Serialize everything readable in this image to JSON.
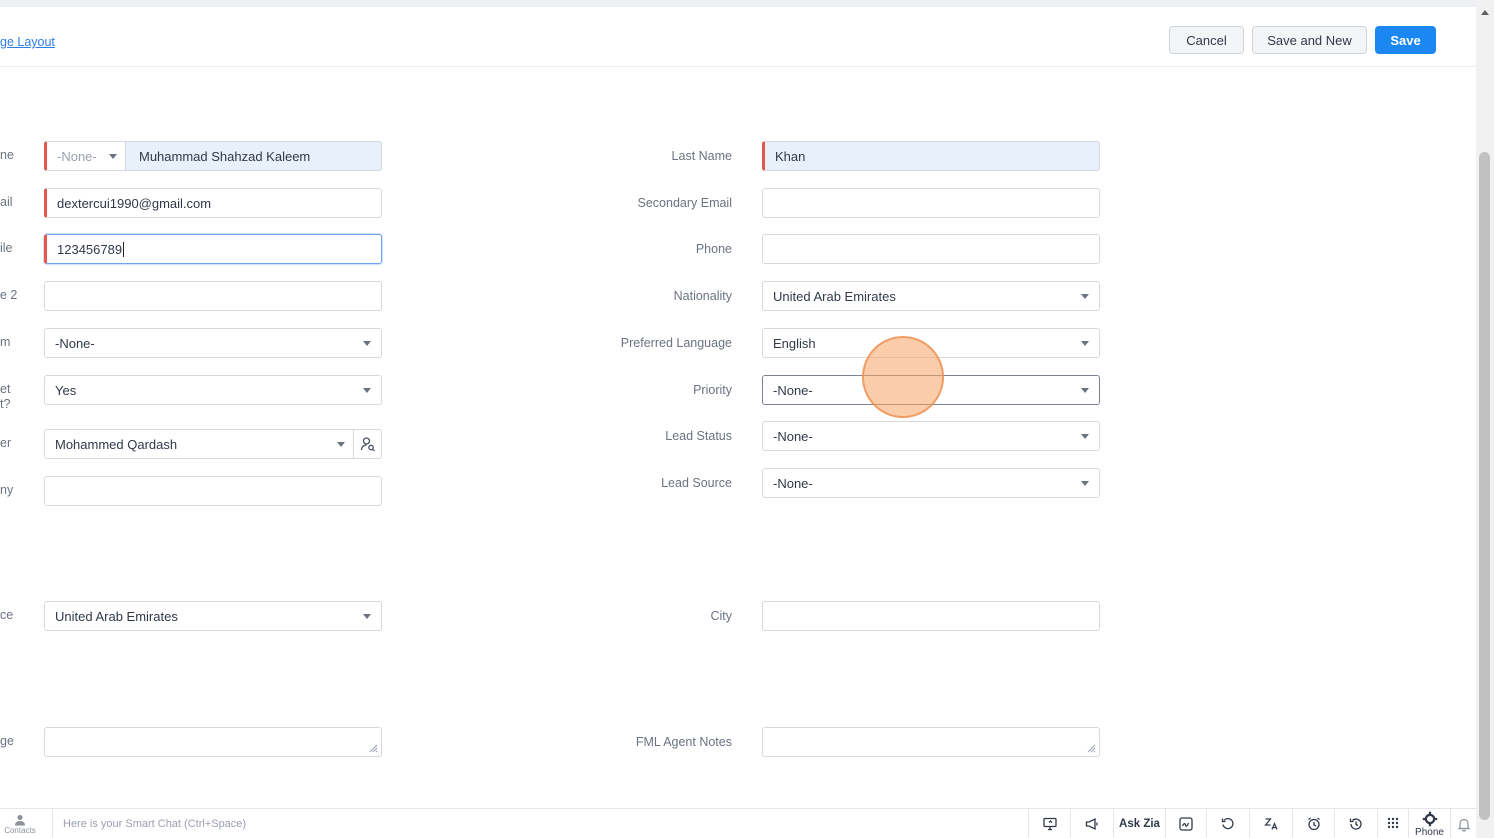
{
  "header": {
    "layout_link": "ge Layout",
    "cancel_label": "Cancel",
    "save_new_label": "Save and New",
    "save_label": "Save"
  },
  "left_fields": {
    "first_name": {
      "label": "ne",
      "salutation": "-None-",
      "value": "Muhammad Shahzad Kaleem"
    },
    "email": {
      "label": "ail",
      "value": "dextercui1990@gmail.com"
    },
    "mobile": {
      "label": "ile",
      "value": "123456789"
    },
    "phone2": {
      "label": "e 2",
      "value": ""
    },
    "platform": {
      "label": "m",
      "value": "-None-"
    },
    "meet": {
      "label_line1": "et",
      "label_line2": "t?",
      "value": "Yes"
    },
    "owner": {
      "label": "er",
      "value": "Mohammed Qardash"
    },
    "company": {
      "label": "ny",
      "value": ""
    },
    "residence": {
      "label": "ce",
      "value": "United Arab Emirates"
    },
    "message": {
      "label": "ge",
      "value": ""
    }
  },
  "right_fields": {
    "last_name": {
      "label": "Last Name",
      "value": "Khan"
    },
    "secondary_email": {
      "label": "Secondary Email",
      "value": ""
    },
    "phone": {
      "label": "Phone",
      "value": ""
    },
    "nationality": {
      "label": "Nationality",
      "value": "United Arab Emirates"
    },
    "preferred_language": {
      "label": "Preferred Language",
      "value": "English"
    },
    "priority": {
      "label": "Priority",
      "value": "-None-"
    },
    "lead_status": {
      "label": "Lead Status",
      "value": "-None-"
    },
    "lead_source": {
      "label": "Lead Source",
      "value": "-None-"
    },
    "city": {
      "label": "City",
      "value": ""
    },
    "fml_agent_notes": {
      "label": "FML Agent Notes",
      "value": ""
    }
  },
  "bottom_bar": {
    "contacts_label": "Contacts",
    "smart_chat_placeholder": "Here is your Smart Chat (Ctrl+Space)",
    "ask_zia_label": "Ask Zia",
    "phone_label": "Phone"
  },
  "colors": {
    "primary": "#1a87f3",
    "mandatory": "#e3564b",
    "link": "#2f7de1",
    "click_marker": "#f5a363"
  },
  "icons": [
    "user-search-icon",
    "contacts-icon",
    "screen-share-icon",
    "megaphone-icon",
    "signature-icon",
    "refresh-icon",
    "translate-icon",
    "alarm-icon",
    "history-icon",
    "dial-pad-icon",
    "phone-gear-icon",
    "bell-icon"
  ]
}
